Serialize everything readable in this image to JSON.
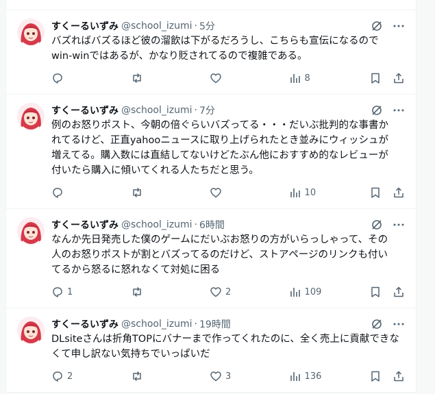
{
  "colors": {
    "text": "#0f1419",
    "muted": "#536471",
    "divider": "#eff3f4"
  },
  "tweets": [
    {
      "name": "すくーるいずみ",
      "handle": "@school_izumi",
      "time": "5分",
      "text": "バズればバズるほど彼の溜飲は下がるだろうし、こちらも宣伝になるので\nwin-winではあるが、かなり貶されてるので複雑である。",
      "replies": "",
      "retweets": "",
      "likes": "",
      "views": "8"
    },
    {
      "name": "すくーるいずみ",
      "handle": "@school_izumi",
      "time": "7分",
      "text": "例のお怒りポスト、今朝の倍ぐらいバズってる・・・だいぶ批判的な事書か\nれてるけど、正直yahooニュースに取り上げられたとき並みにウィッシュが\n増えてる。購入数には直結してないけどたぶん他におすすめ的なレビューが\n付いたら購入に傾いてくれる人たちだと思う。",
      "replies": "",
      "retweets": "",
      "likes": "",
      "views": "10"
    },
    {
      "name": "すくーるいずみ",
      "handle": "@school_izumi",
      "time": "6時間",
      "text": "なんか先日発売した僕のゲームにだいぶお怒りの方がいらっしゃって、その\n人のお怒りポストが割とバズってるのだけど、ストアページのリンクも付い\nてるから怒るに怒れなくて対処に困る",
      "replies": "1",
      "retweets": "",
      "likes": "2",
      "views": "109"
    },
    {
      "name": "すくーるいずみ",
      "handle": "@school_izumi",
      "time": "19時間",
      "text": "DLsiteさんは折角TOPにバナーまで作ってくれたのに、全く売上に貢献できな\nくて申し訳ない気持ちでいっぱいだ",
      "replies": "2",
      "retweets": "",
      "likes": "3",
      "views": "136"
    }
  ]
}
